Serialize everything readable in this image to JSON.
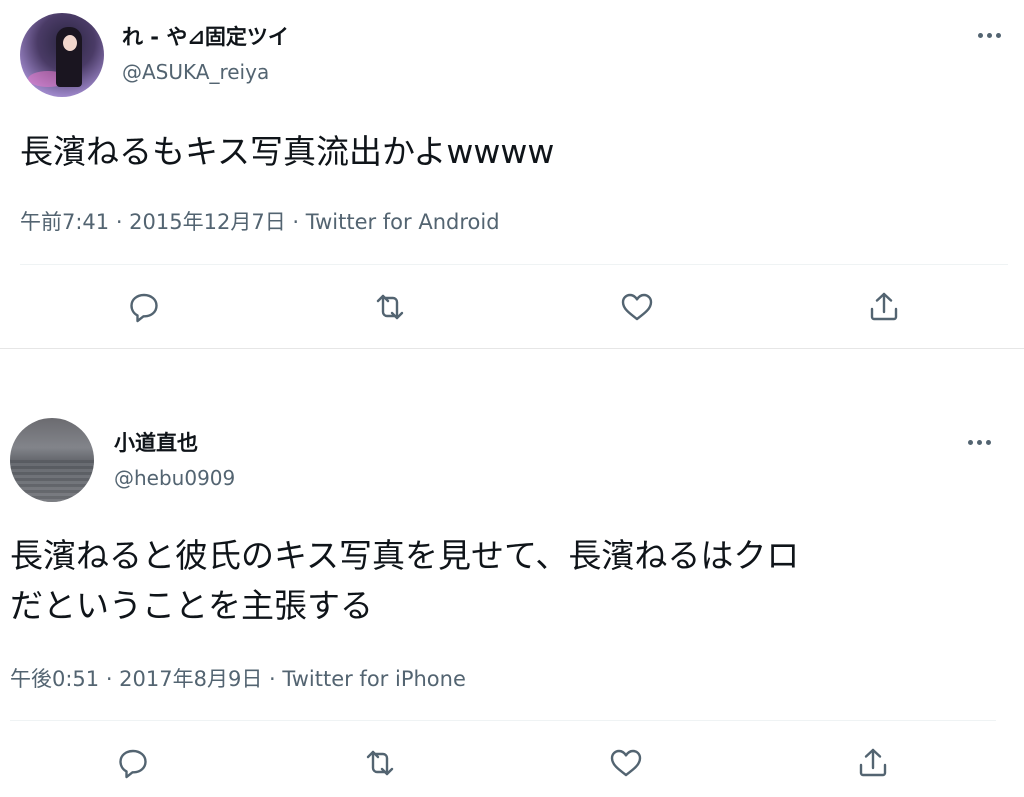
{
  "tweets": [
    {
      "display_name": "れ - や⊿固定ツイ",
      "handle": "@ASUKA_reiya",
      "text_lines": [
        "長濱ねるもキス写真流出かよwwww"
      ],
      "meta": "午前7:41 · 2015年12月7日 · Twitter for Android",
      "more_label": "…"
    },
    {
      "display_name": "小道直也",
      "handle": "@hebu0909",
      "text_lines": [
        "長濱ねると彼氏のキス写真を見せて、長濱ねるはクロ",
        "だということを主張する"
      ],
      "meta": "午後0:51 · 2017年8月9日 · Twitter for iPhone",
      "more_label": "…"
    }
  ],
  "icons": {
    "reply": "reply-icon",
    "retweet": "retweet-icon",
    "like": "heart-icon",
    "share": "share-icon",
    "more": "more-dots-icon"
  },
  "colors": {
    "text": "#0f1419",
    "secondary": "#536471",
    "divider": "#eff3f4"
  }
}
